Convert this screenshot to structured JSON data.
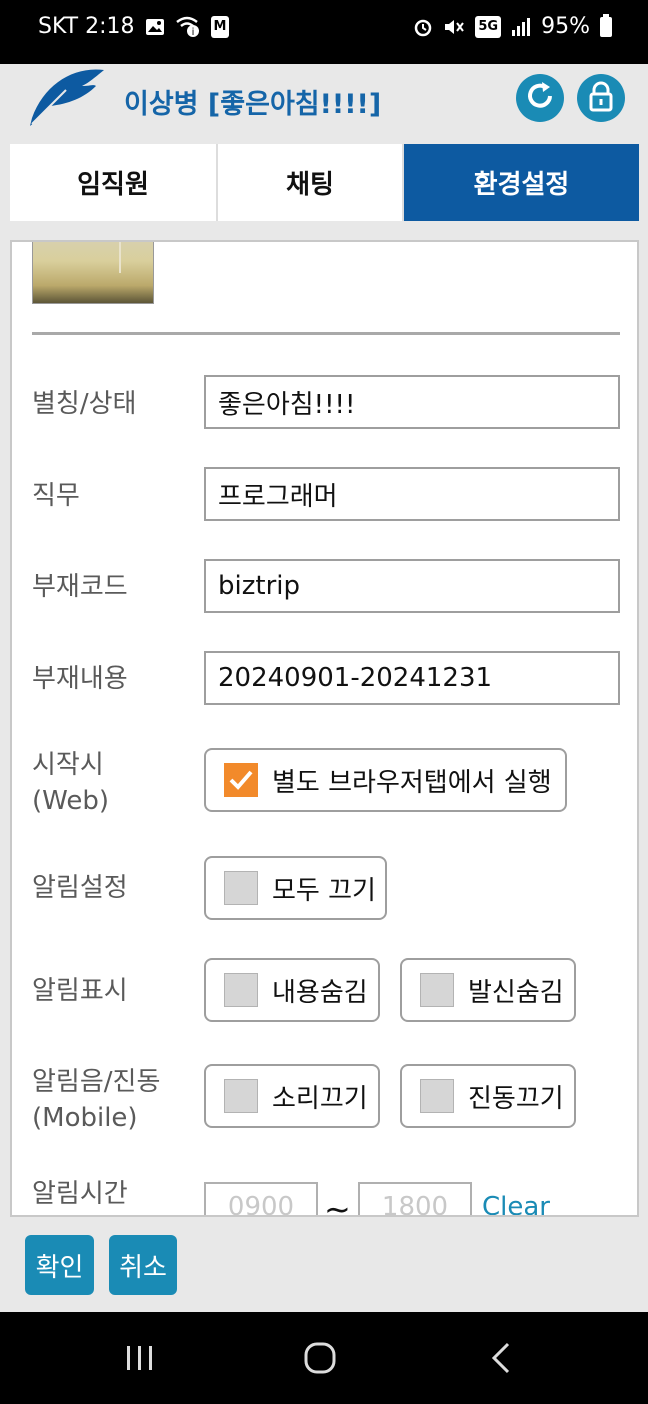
{
  "status_bar": {
    "carrier_time": "SKT 2:18",
    "left_icons": [
      "image-icon",
      "wifi-calling-icon",
      "mstock-icon"
    ],
    "mstock_label": "M",
    "network": "5G",
    "battery": "95%"
  },
  "header": {
    "title": "이상병 [좋은아침!!!!]",
    "refresh_icon": "refresh-icon",
    "lock_icon": "lock-icon",
    "accent_color": "#1a8bb5"
  },
  "tabs": [
    {
      "label": "임직원",
      "active": false
    },
    {
      "label": "채팅",
      "active": false
    },
    {
      "label": "환경설정",
      "active": true
    }
  ],
  "profile": {
    "nickname_label": "별칭/상태",
    "nickname_value": "좋은아침!!!!",
    "job_label": "직무",
    "job_value": "프로그래머",
    "absence_code_label": "부재코드",
    "absence_code_value": "biztrip",
    "absence_content_label": "부재내용",
    "absence_content_value": "20240901-20241231"
  },
  "startup": {
    "label_line1": "시작시",
    "label_line2": "(Web)",
    "option": "별도 브라우저탭에서 실행",
    "checked": true
  },
  "notify_setting": {
    "label": "알림설정",
    "option": "모두 끄기",
    "checked": false
  },
  "notify_display": {
    "label": "알림표시",
    "options": [
      {
        "label": "내용숨김",
        "checked": false
      },
      {
        "label": "발신숨김",
        "checked": false
      }
    ]
  },
  "notify_sound": {
    "label_line1": "알림음/진동",
    "label_line2": "(Mobile)",
    "options": [
      {
        "label": "소리끄기",
        "checked": false
      },
      {
        "label": "진동끄기",
        "checked": false
      }
    ]
  },
  "notify_time": {
    "label": "알림시간",
    "start_placeholder": "0900",
    "end_placeholder": "1800",
    "separator": "~",
    "clear_label": "Clear"
  },
  "footer": {
    "confirm_label": "확인",
    "cancel_label": "취소"
  },
  "colors": {
    "tab_active": "#0d5aa1",
    "title": "#1565a8",
    "checkbox_checked": "#f28a2b"
  }
}
